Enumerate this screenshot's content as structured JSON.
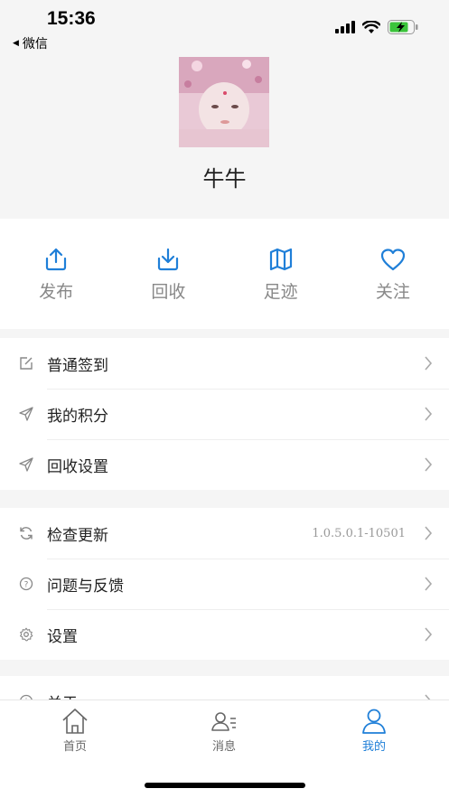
{
  "status": {
    "time": "15:36",
    "back_label": "微信"
  },
  "profile": {
    "nickname": "牛牛"
  },
  "actions": [
    {
      "label": "发布",
      "icon": "upload-icon"
    },
    {
      "label": "回收",
      "icon": "download-icon"
    },
    {
      "label": "足迹",
      "icon": "map-icon"
    },
    {
      "label": "关注",
      "icon": "heart-icon"
    }
  ],
  "menu1": [
    {
      "label": "普通签到",
      "icon": "edit-icon"
    },
    {
      "label": "我的积分",
      "icon": "send-icon"
    },
    {
      "label": "回收设置",
      "icon": "send-icon"
    }
  ],
  "menu2": [
    {
      "label": "检查更新",
      "icon": "refresh-icon",
      "value": "1.0.5.0.1-10501"
    },
    {
      "label": "问题与反馈",
      "icon": "question-icon"
    },
    {
      "label": "设置",
      "icon": "gear-icon"
    }
  ],
  "menu3": [
    {
      "label": "关于",
      "icon": "info-icon"
    }
  ],
  "tabbar": [
    {
      "label": "首页",
      "icon": "home-icon",
      "active": false
    },
    {
      "label": "消息",
      "icon": "contacts-icon",
      "active": false
    },
    {
      "label": "我的",
      "icon": "user-icon",
      "active": true
    }
  ],
  "colors": {
    "accent": "#1f7fd8",
    "inactive": "#666666",
    "divider": "#eeeeee"
  }
}
